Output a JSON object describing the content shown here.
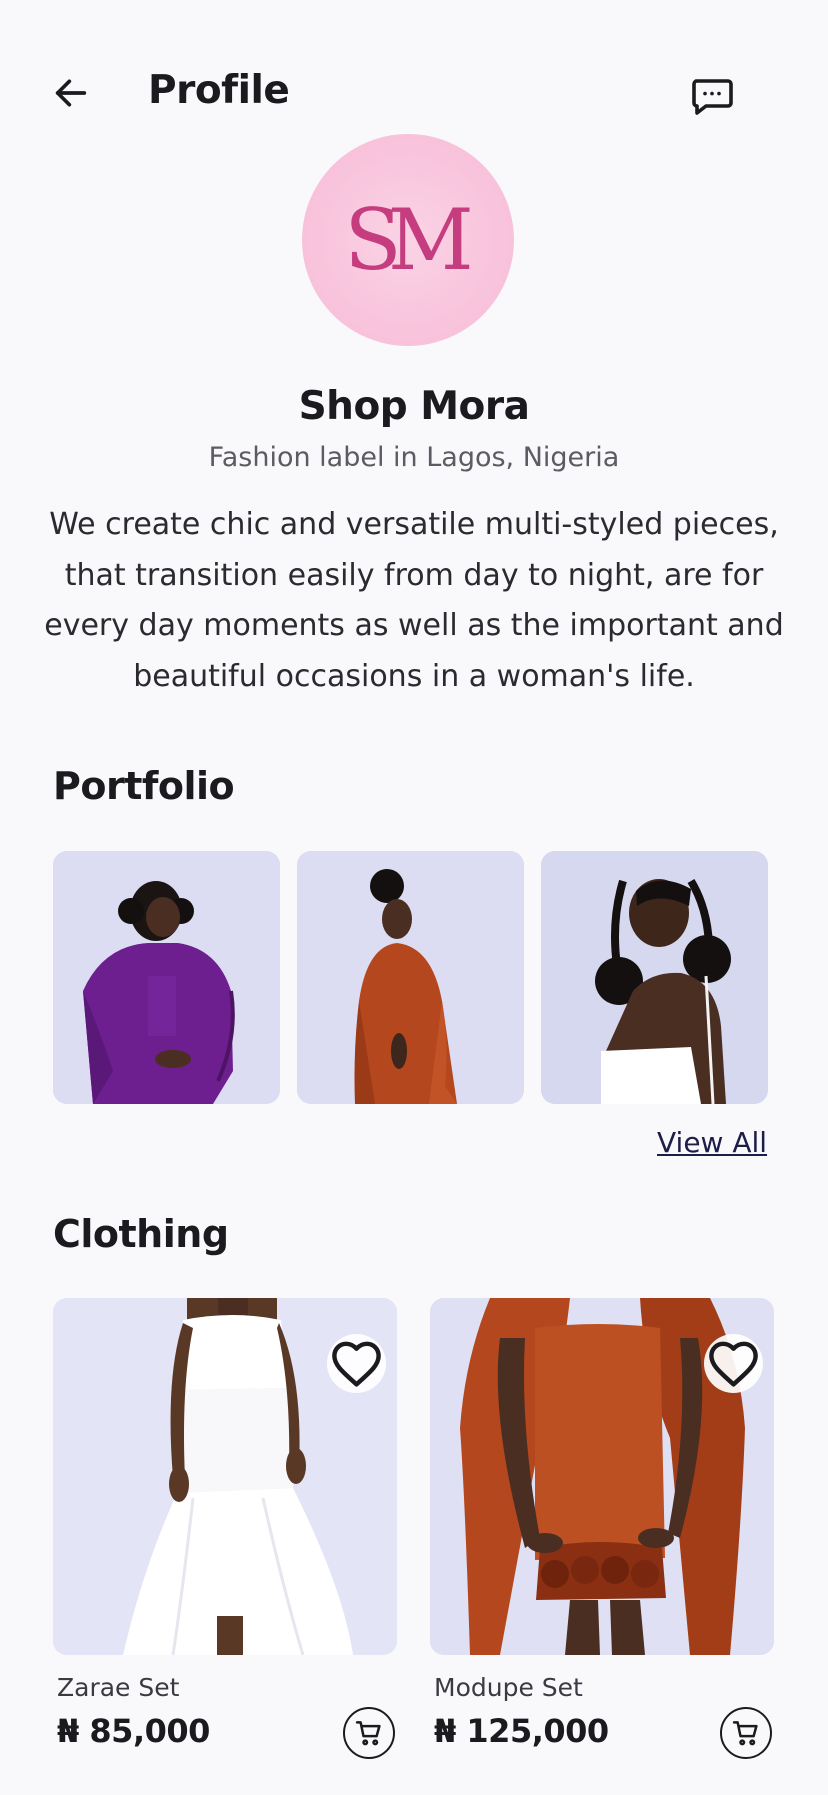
{
  "header": {
    "title": "Profile",
    "back_icon": "arrow-left-icon",
    "chat_icon": "chat-bubble-icon"
  },
  "profile": {
    "avatar_monogram": "SM",
    "name": "Shop Mora",
    "location": "Fashion label in Lagos, Nigeria",
    "description": "We create chic and versatile multi-styled pieces, that transition easily from day to night, are for every day moments as well as the important and beautiful occasions in a woman's life.",
    "avatar_color": "#f8c4dc",
    "monogram_color": "#c53d7f"
  },
  "portfolio": {
    "title": "Portfolio",
    "view_all": "View All",
    "images": [
      {
        "subject": "woman in purple sequin kaftan"
      },
      {
        "subject": "woman in copper metallic kaftan"
      },
      {
        "subject": "woman in white top with puff hair"
      }
    ]
  },
  "clothing": {
    "title": "Clothing",
    "products": [
      {
        "name": "Zarae Set",
        "price": "₦ 85,000",
        "favorite_icon": "heart-outline-icon",
        "cart_icon": "shopping-cart-icon"
      },
      {
        "name": "Modupe Set",
        "price": "₦ 125,000",
        "favorite_icon": "heart-outline-icon",
        "cart_icon": "shopping-cart-icon"
      }
    ]
  }
}
